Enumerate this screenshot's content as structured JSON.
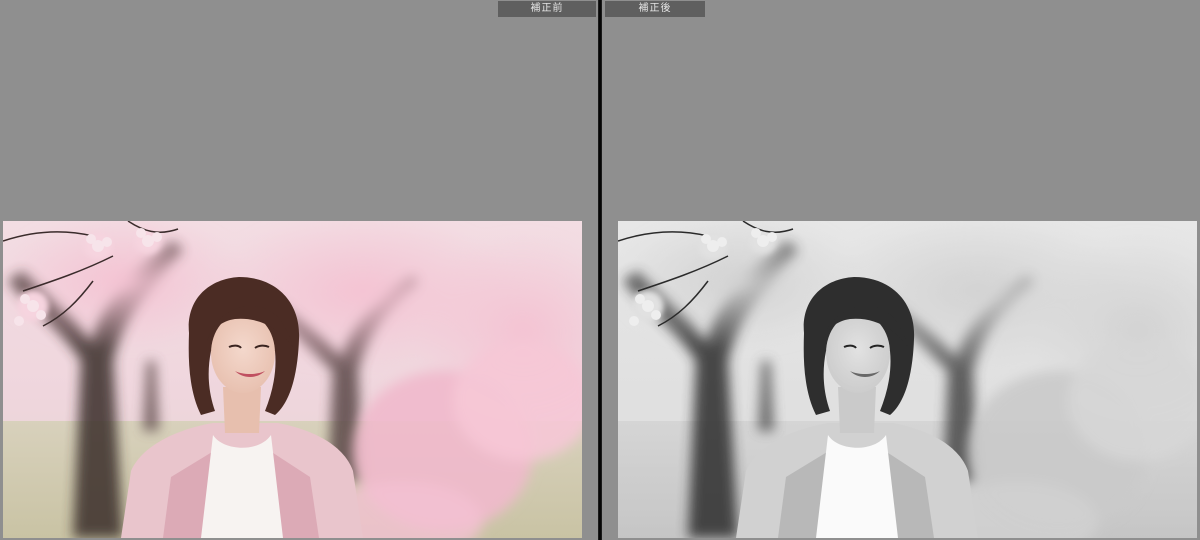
{
  "compare": {
    "before_label": "補正前",
    "after_label": "補正後"
  },
  "colors": {
    "background": "#8f8f8f",
    "label_bg": "#5f5f5f",
    "divider": "#0a0a0a"
  },
  "photos": {
    "before": {
      "mode": "color"
    },
    "after": {
      "mode": "black-and-white"
    }
  }
}
